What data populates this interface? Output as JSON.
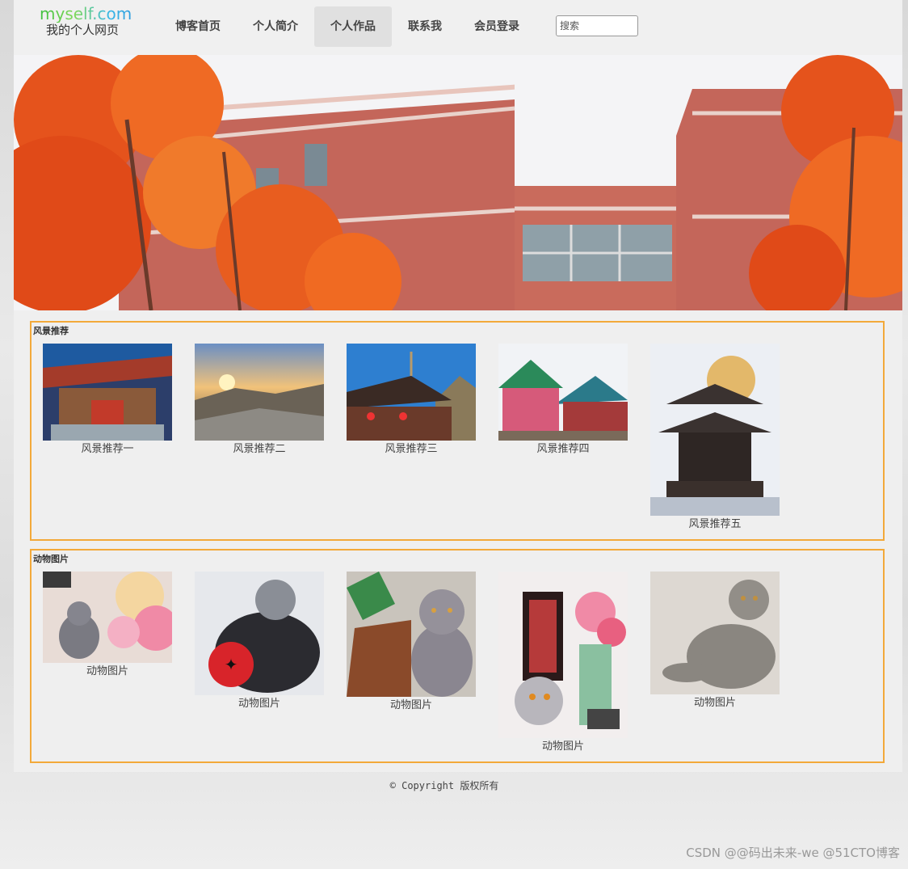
{
  "logo": {
    "en": "myself.com",
    "cn": "我的个人网页"
  },
  "nav": {
    "items": [
      "博客首页",
      "个人简介",
      "个人作品",
      "联系我",
      "会员登录"
    ],
    "active_index": 2
  },
  "search": {
    "placeholder": "搜索"
  },
  "sections": {
    "scenery": {
      "title": "风景推荐",
      "items": [
        "风景推荐一",
        "风景推荐二",
        "风景推荐三",
        "风景推荐四",
        "风景推荐五"
      ]
    },
    "animals": {
      "title": "动物图片",
      "items": [
        "动物图片",
        "动物图片",
        "动物图片",
        "动物图片",
        "动物图片"
      ]
    }
  },
  "footer": {
    "text": "© Copyright 版权所有"
  },
  "watermark": {
    "text": "CSDN @@码出未来-we @51CTO博客"
  },
  "colors": {
    "accent_border": "#f3a93a",
    "brick": "#c4665a",
    "leaves": "#e5531c"
  }
}
